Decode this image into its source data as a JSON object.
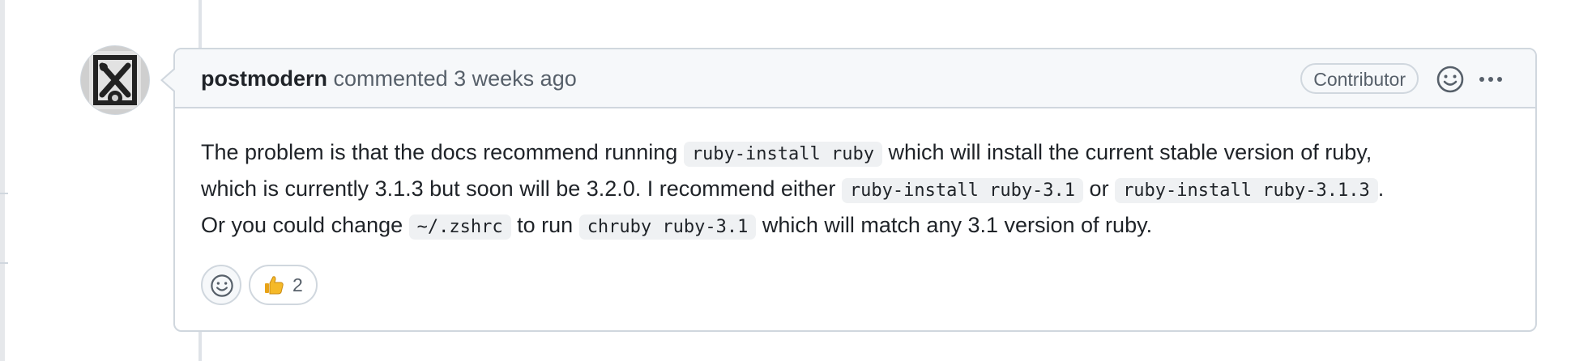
{
  "comment": {
    "author": "postmodern",
    "action": "commented",
    "timestamp": "3 weeks ago",
    "role_badge": "Contributor",
    "body": {
      "line1": {
        "text1": "The problem is that the docs recommend running ",
        "code1": "ruby-install ruby",
        "text2": " which will install the current stable version of ruby,"
      },
      "line2": {
        "text1": "which is currently 3.1.3 but soon will be 3.2.0. I recommend either ",
        "code1": "ruby-install ruby-3.1",
        "text2": " or ",
        "code2": "ruby-install ruby-3.1.3",
        "text3": "."
      },
      "line3": {
        "text1": "Or you could change ",
        "code1": "~/.zshrc",
        "text2": " to run ",
        "code2": "chruby ruby-3.1",
        "text3": " which will match any 3.1 version of ruby."
      }
    },
    "reactions": [
      {
        "icon": "thumbs-up-icon",
        "count": "2"
      }
    ]
  },
  "icons": {
    "add_reaction": "smiley-icon",
    "header_reaction": "smiley-icon",
    "more": "kebab-horizontal-icon"
  },
  "colors": {
    "border": "#d0d7de",
    "header_bg": "#f6f8fa",
    "muted_text": "#57606a",
    "code_bg": "#eff1f3"
  }
}
